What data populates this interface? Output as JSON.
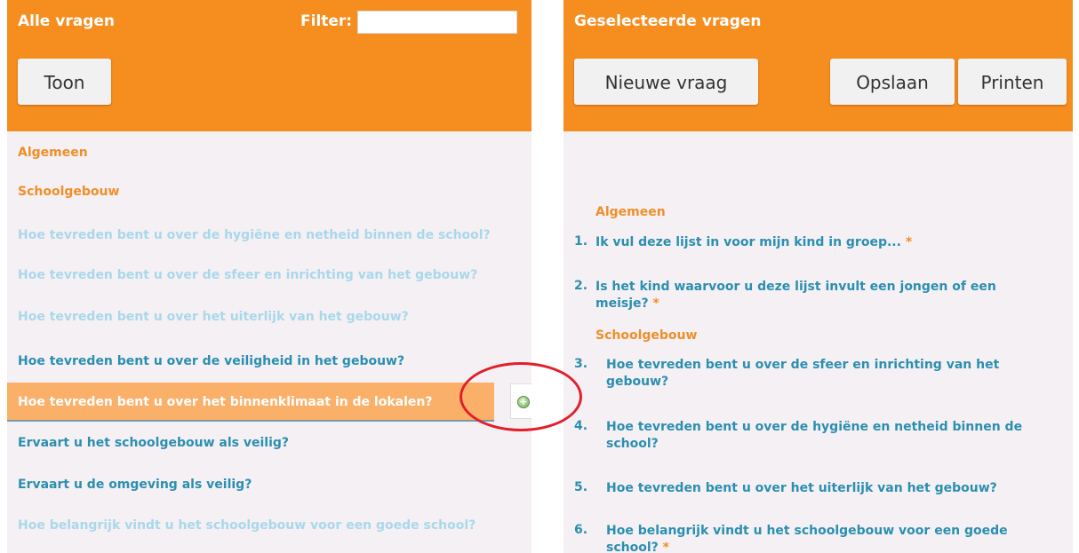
{
  "left": {
    "title": "Alle vragen",
    "filter_label": "Filter:",
    "filter_value": "",
    "button_toon": "Toon",
    "categories": [
      "Algemeen",
      "Schoolgebouw"
    ],
    "questions": [
      {
        "text": "Hoe tevreden bent u over de hygiëne en netheid binnen de school?",
        "state": "light"
      },
      {
        "text": "Hoe tevreden bent u over de sfeer en inrichting van het gebouw?",
        "state": "light"
      },
      {
        "text": "Hoe tevreden bent u over het uiterlijk van het gebouw?",
        "state": "light"
      },
      {
        "text": "Hoe tevreden bent u over de veiligheid in het gebouw?",
        "state": "dark"
      },
      {
        "text": "Hoe tevreden bent u over het binnenklimaat in de lokalen?",
        "state": "highlighted"
      },
      {
        "text": "Ervaart u het schoolgebouw als veilig?",
        "state": "dark"
      },
      {
        "text": "Ervaart u de omgeving als veilig?",
        "state": "dark"
      },
      {
        "text": "Hoe belangrijk vindt u het schoolgebouw voor een goede school?",
        "state": "light"
      }
    ],
    "add_icon": "add-plus-icon"
  },
  "right": {
    "title": "Geselecteerde vragen",
    "button_new": "Nieuwe vraag",
    "button_save": "Opslaan",
    "button_print": "Printen",
    "categories": [
      "Algemeen",
      "Schoolgebouw"
    ],
    "questions": [
      {
        "num": "1.",
        "text": "Ik vul deze lijst in voor mijn kind in groep...",
        "required": true
      },
      {
        "num": "2.",
        "text": "Is het kind waarvoor u deze lijst invult een jongen of een meisje?",
        "required": true
      },
      {
        "num": "3.",
        "text": "Hoe tevreden bent u over de sfeer en inrichting van het gebouw?",
        "required": false
      },
      {
        "num": "4.",
        "text": "Hoe tevreden bent u over de hygiëne en netheid binnen de school?",
        "required": false
      },
      {
        "num": "5.",
        "text": "Hoe tevreden bent u over het uiterlijk van het gebouw?",
        "required": false
      },
      {
        "num": "6.",
        "text": "Hoe belangrijk vindt u het schoolgebouw voor een goede school?",
        "required": true
      }
    ],
    "required_marker": "*"
  },
  "colors": {
    "header_orange": "#f58d1f",
    "category_orange": "#ee8f2a",
    "question_dark": "#2b8fb0",
    "question_light": "#a9d8ea",
    "highlight_row": "#fbb06a",
    "annotation_circle": "#e0202a"
  }
}
